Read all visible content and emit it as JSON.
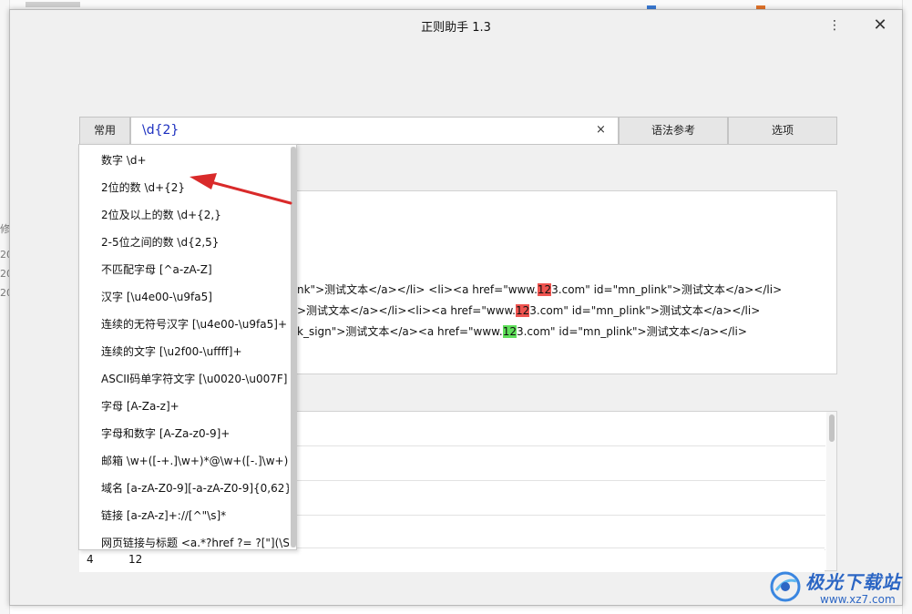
{
  "window": {
    "title": "正则助手 1.3",
    "minimize_glyph": "⋮",
    "close_glyph": "✕"
  },
  "toolbar": {
    "common_label": "常用",
    "regex_value": "\\d{2}",
    "clear_glyph": "×",
    "syntax_label": "语法参考",
    "options_label": "选项"
  },
  "background": {
    "left_fragments": [
      "修",
      "20",
      "20",
      "20"
    ]
  },
  "dropdown": {
    "items": [
      "数字 \\d+",
      "2位的数 \\d+{2}",
      "2位及以上的数 \\d+{2,}",
      "2-5位之间的数 \\d{2,5}",
      "不匹配字母 [^a-zA-Z]",
      "汉字 [\\u4e00-\\u9fa5]",
      "连续的无符号汉字 [\\u4e00-\\u9fa5]+",
      "连续的文字 [\\u2f00-\\uffff]+",
      "ASCII码单字符文字 [\\u0020-\\u007F]",
      "字母 [A-Za-z]+",
      "字母和数字 [A-Za-z0-9]+",
      "邮箱 \\w+([-+.]\\w+)*@\\w+([-.]\\w+)",
      "域名 [a-zA-Z0-9][-a-zA-Z0-9]{0,62}",
      "链接 [a-zA-z]+://[^\"\\s]*",
      "网页链接与标题 <a.*?href ?= ?[\"](\\S"
    ]
  },
  "text_area": {
    "line1": {
      "a": "nk\">测试文本</a></li>    <li><a href=\"www.",
      "b": "12",
      "c": "3.com\" id=\"mn_plink\">测试文本</a></li>"
    },
    "line2": {
      "a": ">测试文本</a></li><li><a href=\"www.",
      "b": "12",
      "c": "3.com\" id=\"mn_plink\">测试文本</a></li>"
    },
    "line3": {
      "a": "k_sign\">测试文本</a><a href=\"www.",
      "b": "12",
      "c": "3.com\" id=\"mn_plink\">测试文本</a></li>"
    },
    "highlight_colors": {
      "red": "#ef5450",
      "green": "#5fe05a"
    }
  },
  "results": {
    "bottom_row": {
      "index": "4",
      "value": "12"
    }
  },
  "watermark": {
    "name": "极光下载站",
    "url": "www.xz7.com"
  }
}
